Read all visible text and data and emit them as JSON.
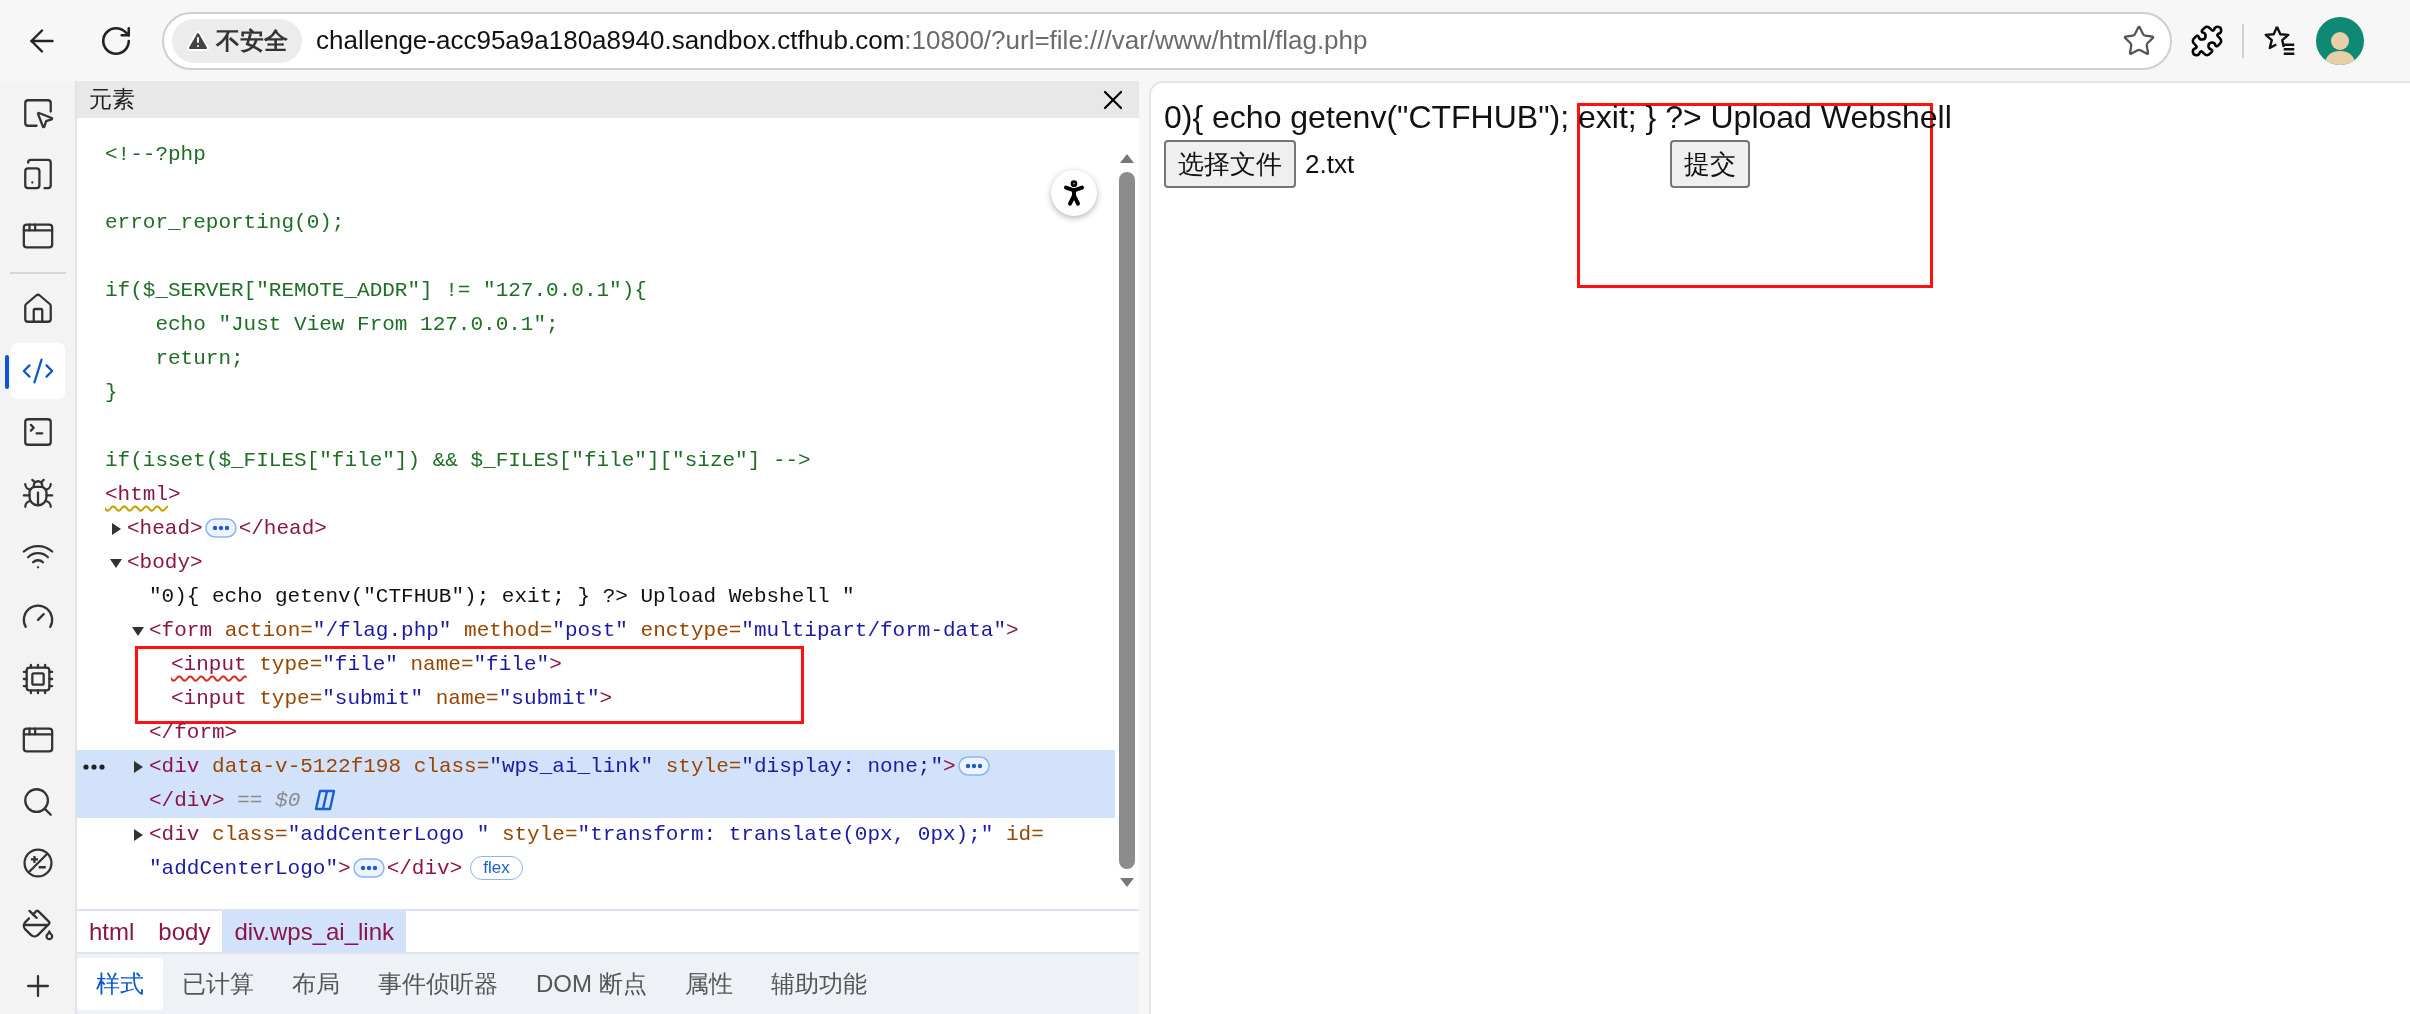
{
  "browser": {
    "security_label": "不安全",
    "url_host": "challenge-acc95a9a180a8940.sandbox.ctfhub.com",
    "url_rest": ":10800/?url=file:///var/www/html/flag.php"
  },
  "devtools": {
    "panel_title": "元素",
    "activity_bar": {
      "top": [
        {
          "kind": "inspect",
          "selected": false
        },
        {
          "kind": "device",
          "selected": false
        },
        {
          "kind": "window",
          "selected": false
        }
      ],
      "main": [
        {
          "kind": "home",
          "selected": false
        },
        {
          "kind": "elements",
          "selected": true
        },
        {
          "kind": "console",
          "selected": false
        },
        {
          "kind": "bug",
          "selected": false
        },
        {
          "kind": "wifi",
          "selected": false
        },
        {
          "kind": "gauge",
          "selected": false
        },
        {
          "kind": "chip",
          "selected": false
        },
        {
          "kind": "window",
          "selected": false
        },
        {
          "kind": "search",
          "selected": false
        },
        {
          "kind": "plusminus",
          "selected": false
        },
        {
          "kind": "paint",
          "selected": false
        },
        {
          "kind": "plus",
          "selected": false
        }
      ]
    },
    "dom": [
      {
        "kind": "comment",
        "selected": false,
        "text": "<!--?php\n\nerror_reporting(0);\n\nif($_SERVER[\"REMOTE_ADDR\"] != \"127.0.0.1\"){\n    echo \"Just View From 127.0.0.1\";\n    return;\n}\n\nif(isset($_FILES[\"file\"]) && $_FILES[\"file\"][\"size\"] -->"
      },
      {
        "kind": "root",
        "selected": false,
        "open": "<html",
        "open_end": ">",
        "has_warning": true,
        "children": [
          {
            "kind": "element",
            "selected": false,
            "expanded": false,
            "open": "<head",
            "open_end": ">",
            "close": "</head>"
          },
          {
            "kind": "element",
            "selected": false,
            "expanded": true,
            "open": "<body",
            "open_end": ">",
            "children": [
              {
                "kind": "text",
                "selected": false,
                "text": "\"0){ echo getenv(\"CTFHUB\"); exit; } ?> Upload Webshell \""
              },
              {
                "kind": "element",
                "selected": false,
                "expanded": true,
                "open": "<form",
                "attributes": [
                  {
                    "name": "action=",
                    "value": "\"/flag.php\""
                  },
                  {
                    "name": "method=",
                    "value": "\"post\""
                  },
                  {
                    "name": "enctype=",
                    "value": "\"multipart/form-data\""
                  }
                ],
                "open_end": ">",
                "close": "</form>",
                "boxed_children": true,
                "children": [
                  {
                    "kind": "leaf",
                    "selected": false,
                    "open": "<input",
                    "has_error": true,
                    "attributes": [
                      {
                        "name": "type=",
                        "value": "\"file\""
                      },
                      {
                        "name": "name=",
                        "value": "\"file\""
                      }
                    ],
                    "open_end": ">"
                  },
                  {
                    "kind": "leaf",
                    "selected": false,
                    "open": "<input",
                    "attributes": [
                      {
                        "name": "type=",
                        "value": "\"submit\""
                      },
                      {
                        "name": "name=",
                        "value": "\"submit\""
                      }
                    ],
                    "open_end": ">"
                  }
                ]
              },
              {
                "kind": "element",
                "selected": true,
                "expanded": false,
                "open": "<div",
                "attributes": [
                  {
                    "name": "data-v-5122f198"
                  },
                  {
                    "name": "class=",
                    "value": "\"wps_ai_link\""
                  },
                  {
                    "name": "style=",
                    "value": "\"display: none;\""
                  }
                ],
                "open_end": ">",
                "close": "</div>",
                "marker": "== $0"
              },
              {
                "kind": "element",
                "selected": false,
                "expanded": false,
                "open": "<div",
                "attributes": [
                  {
                    "name": "class=",
                    "value": "\"addCenterLogo \""
                  },
                  {
                    "name": "style=",
                    "value": "\"transform: translate(0px, 0px);\""
                  },
                  {
                    "name": "id=",
                    "value": "\"addCenterLogo\""
                  }
                ],
                "open_end": ">",
                "close": "</div>",
                "badge": "flex"
              }
            ]
          }
        ]
      }
    ],
    "breadcrumbs": [
      {
        "label": "html",
        "selected": false
      },
      {
        "label": "body",
        "selected": false
      },
      {
        "label": "div.wps_ai_link",
        "selected": true
      }
    ],
    "tabs": [
      {
        "label": "样式",
        "selected": true
      },
      {
        "label": "已计算",
        "selected": false
      },
      {
        "label": "布局",
        "selected": false
      },
      {
        "label": "事件侦听器",
        "selected": false
      },
      {
        "label": "DOM 断点",
        "selected": false
      },
      {
        "label": "属性",
        "selected": false
      },
      {
        "label": "辅助功能",
        "selected": false
      }
    ]
  },
  "page": {
    "text": "0){ echo getenv(\"CTFHUB\"); exit; } ?> Upload Webshell",
    "file_button": "选择文件",
    "file_name": "2.txt",
    "submit": "提交",
    "annotation_box": true
  }
}
